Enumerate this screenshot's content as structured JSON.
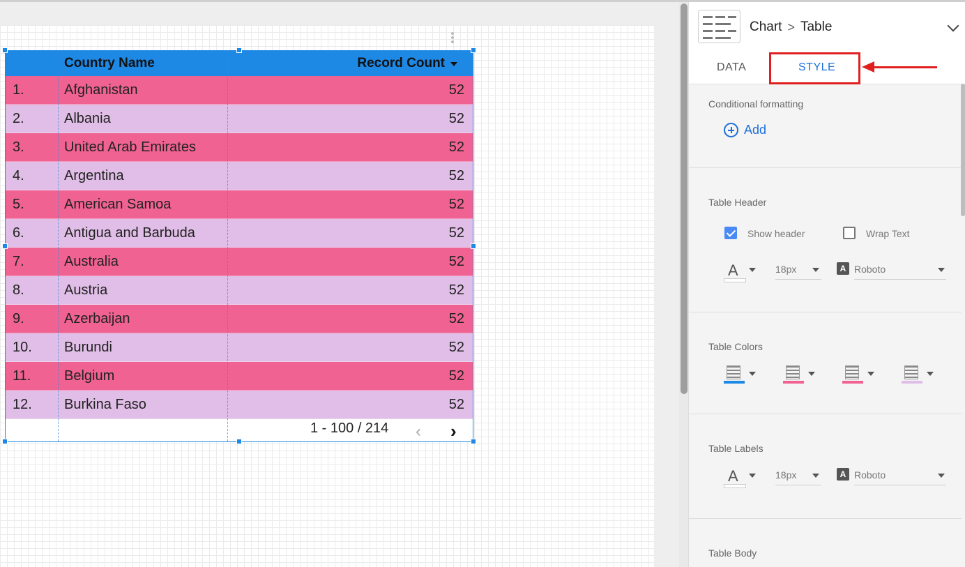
{
  "table": {
    "header": {
      "col_name": "Country Name",
      "col_count": "Record Count"
    },
    "rows": [
      {
        "num": "1.",
        "name": "Afghanistan",
        "count": "52"
      },
      {
        "num": "2.",
        "name": "Albania",
        "count": "52"
      },
      {
        "num": "3.",
        "name": "United Arab Emirates",
        "count": "52"
      },
      {
        "num": "4.",
        "name": "Argentina",
        "count": "52"
      },
      {
        "num": "5.",
        "name": "American Samoa",
        "count": "52"
      },
      {
        "num": "6.",
        "name": "Antigua and Barbuda",
        "count": "52"
      },
      {
        "num": "7.",
        "name": "Australia",
        "count": "52"
      },
      {
        "num": "8.",
        "name": "Austria",
        "count": "52"
      },
      {
        "num": "9.",
        "name": "Azerbaijan",
        "count": "52"
      },
      {
        "num": "10.",
        "name": "Burundi",
        "count": "52"
      },
      {
        "num": "11.",
        "name": "Belgium",
        "count": "52"
      },
      {
        "num": "12.",
        "name": "Burkina Faso",
        "count": "52"
      }
    ],
    "pager": {
      "range": "1 - 100 / 214",
      "prev": "‹",
      "next": "›"
    },
    "colors": {
      "header": "#1e88e5",
      "odd_row": "#f06292",
      "even_row": "#e1bee7"
    }
  },
  "panel": {
    "breadcrumb": {
      "chart": "Chart",
      "sep": ">",
      "type": "Table"
    },
    "tabs": {
      "data": "DATA",
      "style": "STYLE"
    },
    "conditional": {
      "label": "Conditional formatting",
      "add": "Add"
    },
    "table_header": {
      "label": "Table Header",
      "show_header": "Show header",
      "wrap_text": "Wrap Text",
      "font_letter": "A",
      "font_size": "18px",
      "font_family": "Roboto"
    },
    "table_colors": {
      "label": "Table Colors",
      "bars": [
        "#1e88e5",
        "#f06292",
        "#f06292",
        "#e1bee7"
      ]
    },
    "table_labels": {
      "label": "Table Labels",
      "font_letter": "A",
      "font_size": "18px",
      "font_family": "Roboto"
    },
    "table_body": {
      "label": "Table Body"
    },
    "accent": "#1e6fd9",
    "annotation_color": "#e02020"
  }
}
